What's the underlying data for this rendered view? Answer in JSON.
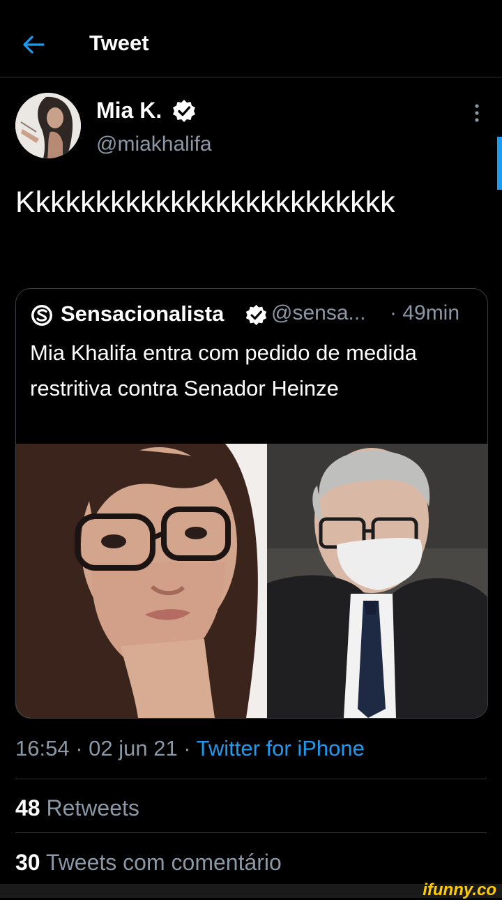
{
  "header": {
    "title": "Tweet",
    "back_icon": "arrow-left-icon"
  },
  "tweet": {
    "author_name": "Mia K.",
    "handle": "@miakhalifa",
    "text": "Kkkkkkkkkkkkkkkkkkkkkkkkk",
    "more_icon": "more-vertical-icon"
  },
  "quote": {
    "name": "Sensacionalista",
    "handle": "@sensa...",
    "time": "· 49min",
    "text": "Mia Khalifa entra com pedido de medida restritiva contra Senador Heinze"
  },
  "meta": {
    "time": "16:54 · 02 jun 21 · ",
    "source": "Twitter for iPhone"
  },
  "stats": {
    "retweets_count": "48",
    "retweets_label": "Retweets",
    "quotes_count": "30",
    "quotes_label": "Tweets com comentário"
  },
  "watermark": "ifunny.co",
  "colors": {
    "accent": "#1d9bf0",
    "secondary_text": "#8b98a5",
    "background": "#000000",
    "watermark": "#ffcc00"
  }
}
